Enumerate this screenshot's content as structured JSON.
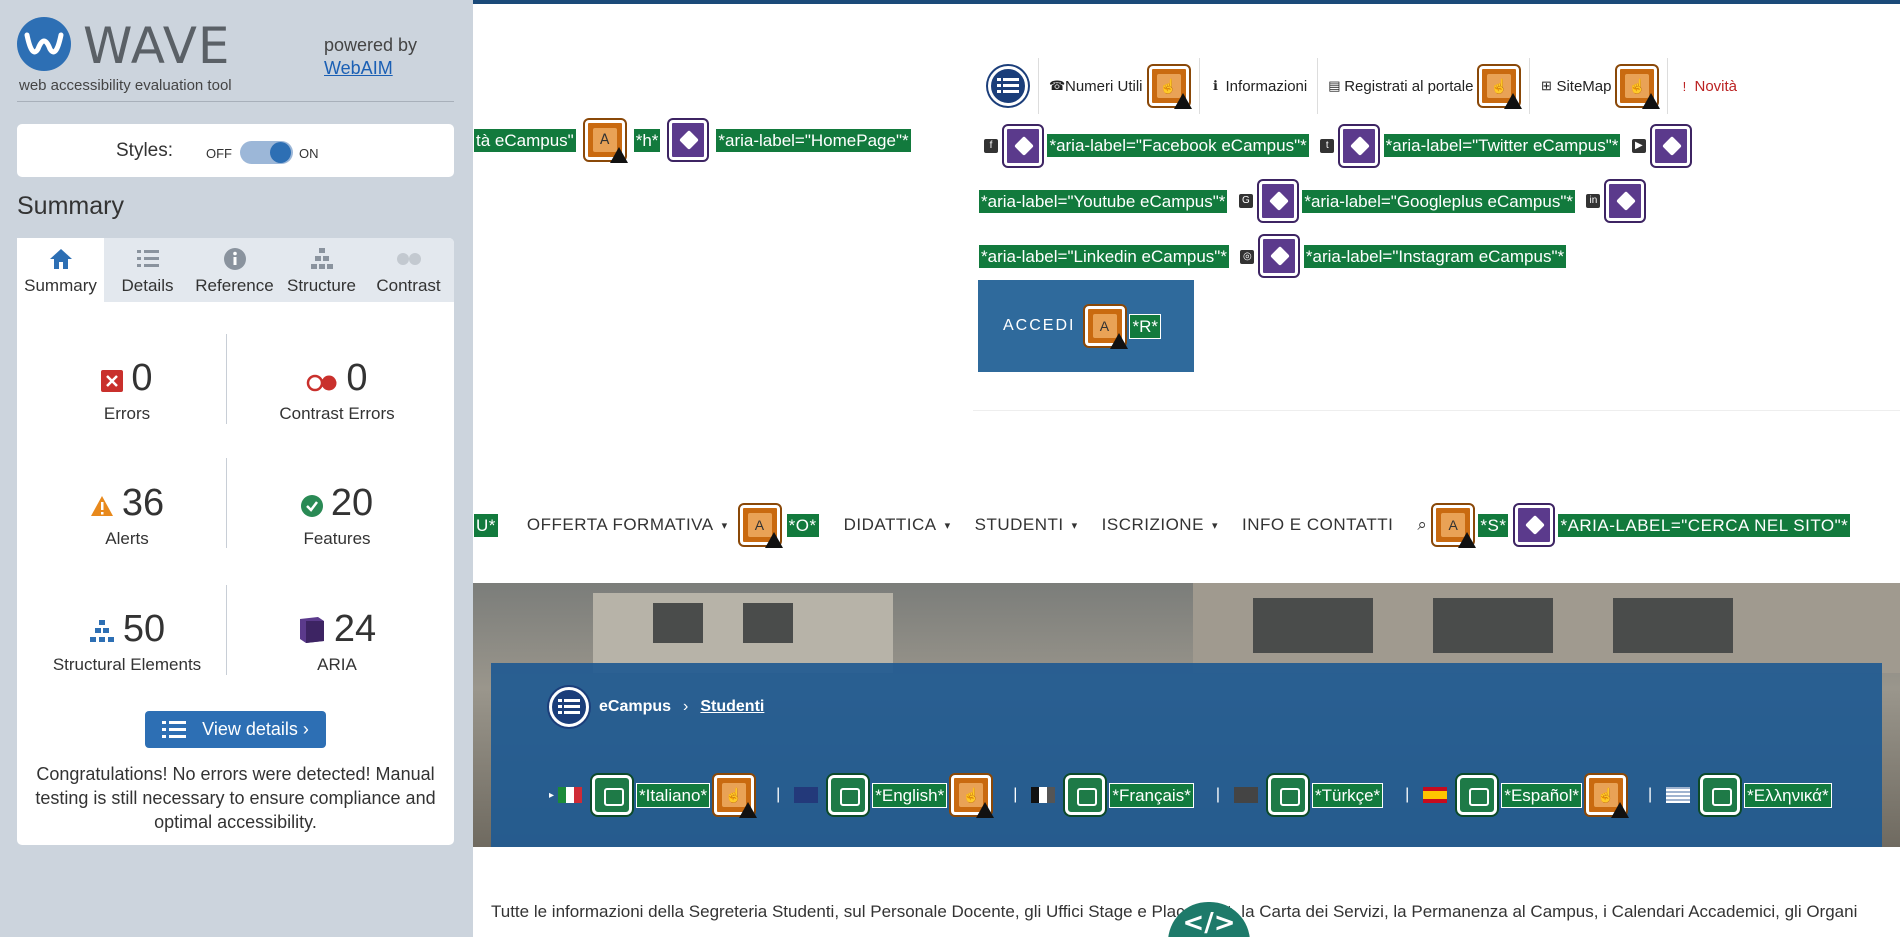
{
  "wave": {
    "logo_word": "WAVE",
    "logo_sub": "web accessibility evaluation tool",
    "powered_by": "powered by",
    "webaim_link": "WebAIM",
    "styles": {
      "label": "Styles:",
      "off": "OFF",
      "on": "ON",
      "state": "on"
    },
    "summary_heading": "Summary",
    "tabs": [
      {
        "label": "Summary",
        "icon": "home-icon",
        "active": true
      },
      {
        "label": "Details",
        "icon": "list-icon",
        "active": false
      },
      {
        "label": "Reference",
        "icon": "info-icon",
        "active": false
      },
      {
        "label": "Structure",
        "icon": "hierarchy-icon",
        "active": false
      },
      {
        "label": "Contrast",
        "icon": "contrast-icon",
        "active": false
      }
    ],
    "stats": {
      "errors": {
        "value": "0",
        "label": "Errors"
      },
      "contrast_errors": {
        "value": "0",
        "label": "Contrast Errors"
      },
      "alerts": {
        "value": "36",
        "label": "Alerts"
      },
      "features": {
        "value": "20",
        "label": "Features"
      },
      "structural": {
        "value": "50",
        "label": "Structural Elements"
      },
      "aria": {
        "value": "24",
        "label": "ARIA"
      }
    },
    "view_details": "View details ›",
    "congrats": "Congratulations! No errors were detected! Manual testing is still necessary to ensure compliance and optimal accessibility."
  },
  "page": {
    "top_nav": [
      {
        "label": "Numeri Utili",
        "icon": "phone-icon"
      },
      {
        "label": "Informazioni",
        "icon": "info-icon"
      },
      {
        "label": "Registrati al portale",
        "icon": "id-card-icon"
      },
      {
        "label": "SiteMap",
        "icon": "sitemap-icon"
      },
      {
        "label": "Novità",
        "icon": "exclamation-icon"
      }
    ],
    "left_fragment": "tà eCampus\"",
    "left_h": "*h*",
    "left_aria": "*aria-label=\"HomePage\"*",
    "social_aria": [
      "*aria-label=\"Facebook eCampus\"*",
      "*aria-label=\"Twitter eCampus\"*",
      "*aria-label=\"Youtube eCampus\"*",
      "*aria-label=\"Googleplus eCampus\"*",
      "*aria-label=\"Linkedin eCampus\"*",
      "*aria-label=\"Instagram eCampus\"*"
    ],
    "accedi": "ACCEDI",
    "accedi_r": "*R*",
    "menu_left_frag": "U*",
    "menu": [
      {
        "label": "OFFERTA FORMATIVA"
      },
      {
        "label": "DIDATTICA"
      },
      {
        "label": "STUDENTI"
      },
      {
        "label": "ISCRIZIONE"
      },
      {
        "label": "INFO E CONTATTI"
      }
    ],
    "menu_o": "*O*",
    "search_s": "*S*",
    "search_aria": "*ARIA-LABEL=\"CERCA NEL SITO\"*",
    "breadcrumb": {
      "home": "eCampus",
      "current": "Studenti"
    },
    "languages": [
      {
        "label": "*Italiano*",
        "flag": "it"
      },
      {
        "label": "*English*",
        "flag": "gb"
      },
      {
        "label": "*Français*",
        "flag": "fr"
      },
      {
        "label": "*Türkçe*",
        "flag": "tr"
      },
      {
        "label": "*Español*",
        "flag": "es"
      },
      {
        "label": "*Ελληνικά*",
        "flag": "gr"
      }
    ],
    "paragraph": "Tutte le informazioni della Segreteria Studenti, sul Personale Docente, gli Uffici Stage e Placement, la Carta dei Servizi, la Permanenza al Campus, i Calendari Accademici, gli Organi",
    "code_button": "</>"
  }
}
